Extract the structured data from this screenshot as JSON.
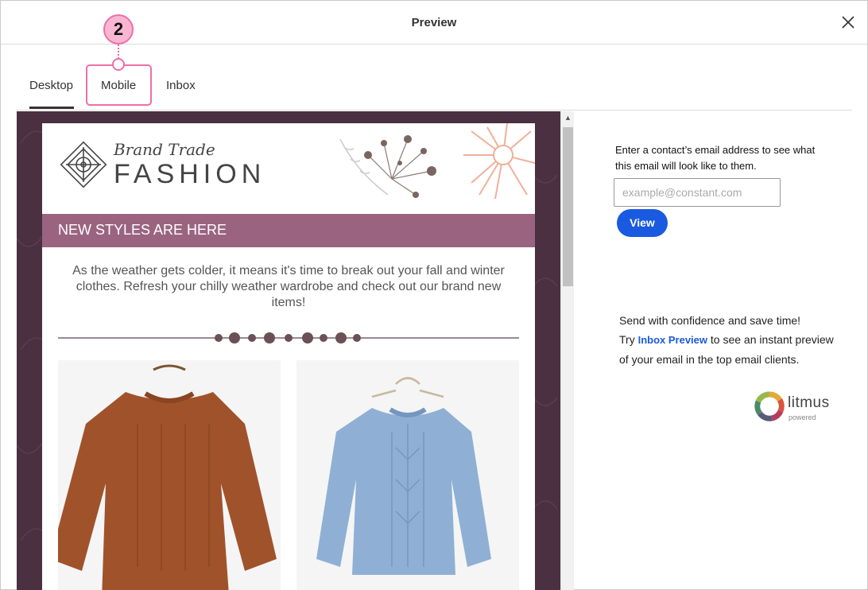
{
  "dialog": {
    "title": "Preview",
    "close_icon": "close-icon"
  },
  "tabs": [
    {
      "label": "Desktop",
      "active": true
    },
    {
      "label": "Mobile",
      "active": false
    },
    {
      "label": "Inbox",
      "active": false
    }
  ],
  "callout": {
    "number": "2",
    "color": "#ee6fa6"
  },
  "email": {
    "brand_script": "Brand Trade",
    "brand_name": "FASHION",
    "banner": "NEW STYLES ARE HERE",
    "banner_color": "#9a6480",
    "intro": "As the weather gets colder, it means it's time to break out your fall and winter clothes. Refresh your chilly weather wardrobe and check out our brand new items!",
    "products": [
      {
        "name": "rust-sweater",
        "color": "#a0532a"
      },
      {
        "name": "blue-sweater",
        "color": "#8fb0d4"
      }
    ],
    "frame_color": "#4a3040"
  },
  "side": {
    "prompt": "Enter a contact’s email address to see what this email will look like to them.",
    "email_placeholder": "example@constant.com",
    "view_label": "View",
    "accent": "#1a5ae0"
  },
  "promo": {
    "line1": "Send with confidence and save time!",
    "try": "Try",
    "link_label": "Inbox Preview",
    "rest": "to see an instant preview of your email in the top email clients.",
    "litmus_word": "litmus",
    "litmus_sub": "powered"
  }
}
